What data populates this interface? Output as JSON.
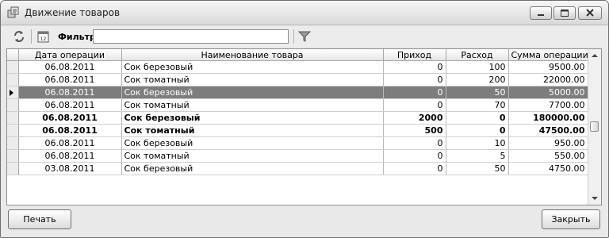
{
  "window": {
    "title": "Движение товаров",
    "min_icon": "minimize-icon",
    "max_icon": "maximize-icon",
    "close_icon": "close-icon"
  },
  "toolbar": {
    "refresh_icon": "refresh-icon",
    "calendar_icon": "calendar-icon",
    "calendar_text": "12",
    "filter_label": "Фильтр",
    "filter_value": "",
    "filter_icon": "funnel-icon"
  },
  "table": {
    "columns": [
      "Дата операции",
      "Наименование товара",
      "Приход",
      "Расход",
      "Сумма операции"
    ],
    "rows": [
      {
        "date": "06.08.2011",
        "name": "Сок березовый",
        "income": "0",
        "expense": "100",
        "sum": "9500.00",
        "selected": false,
        "bold": false
      },
      {
        "date": "06.08.2011",
        "name": "Сок томатный",
        "income": "0",
        "expense": "200",
        "sum": "22000.00",
        "selected": false,
        "bold": false
      },
      {
        "date": "06.08.2011",
        "name": "Сок березовый",
        "income": "0",
        "expense": "50",
        "sum": "5000.00",
        "selected": true,
        "bold": false
      },
      {
        "date": "06.08.2011",
        "name": "Сок томатный",
        "income": "0",
        "expense": "70",
        "sum": "7700.00",
        "selected": false,
        "bold": false
      },
      {
        "date": "06.08.2011",
        "name": "Сок березовый",
        "income": "2000",
        "expense": "0",
        "sum": "180000.00",
        "selected": false,
        "bold": true
      },
      {
        "date": "06.08.2011",
        "name": "Сок томатный",
        "income": "500",
        "expense": "0",
        "sum": "47500.00",
        "selected": false,
        "bold": true
      },
      {
        "date": "06.08.2011",
        "name": "Сок березовый",
        "income": "0",
        "expense": "10",
        "sum": "950.00",
        "selected": false,
        "bold": false
      },
      {
        "date": "06.08.2011",
        "name": "Сок томатный",
        "income": "0",
        "expense": "5",
        "sum": "550.00",
        "selected": false,
        "bold": false
      },
      {
        "date": "03.08.2011",
        "name": "Сок березовый",
        "income": "0",
        "expense": "50",
        "sum": "4750.00",
        "selected": false,
        "bold": false
      }
    ]
  },
  "buttons": {
    "print": "Печать",
    "close": "Закрыть"
  }
}
